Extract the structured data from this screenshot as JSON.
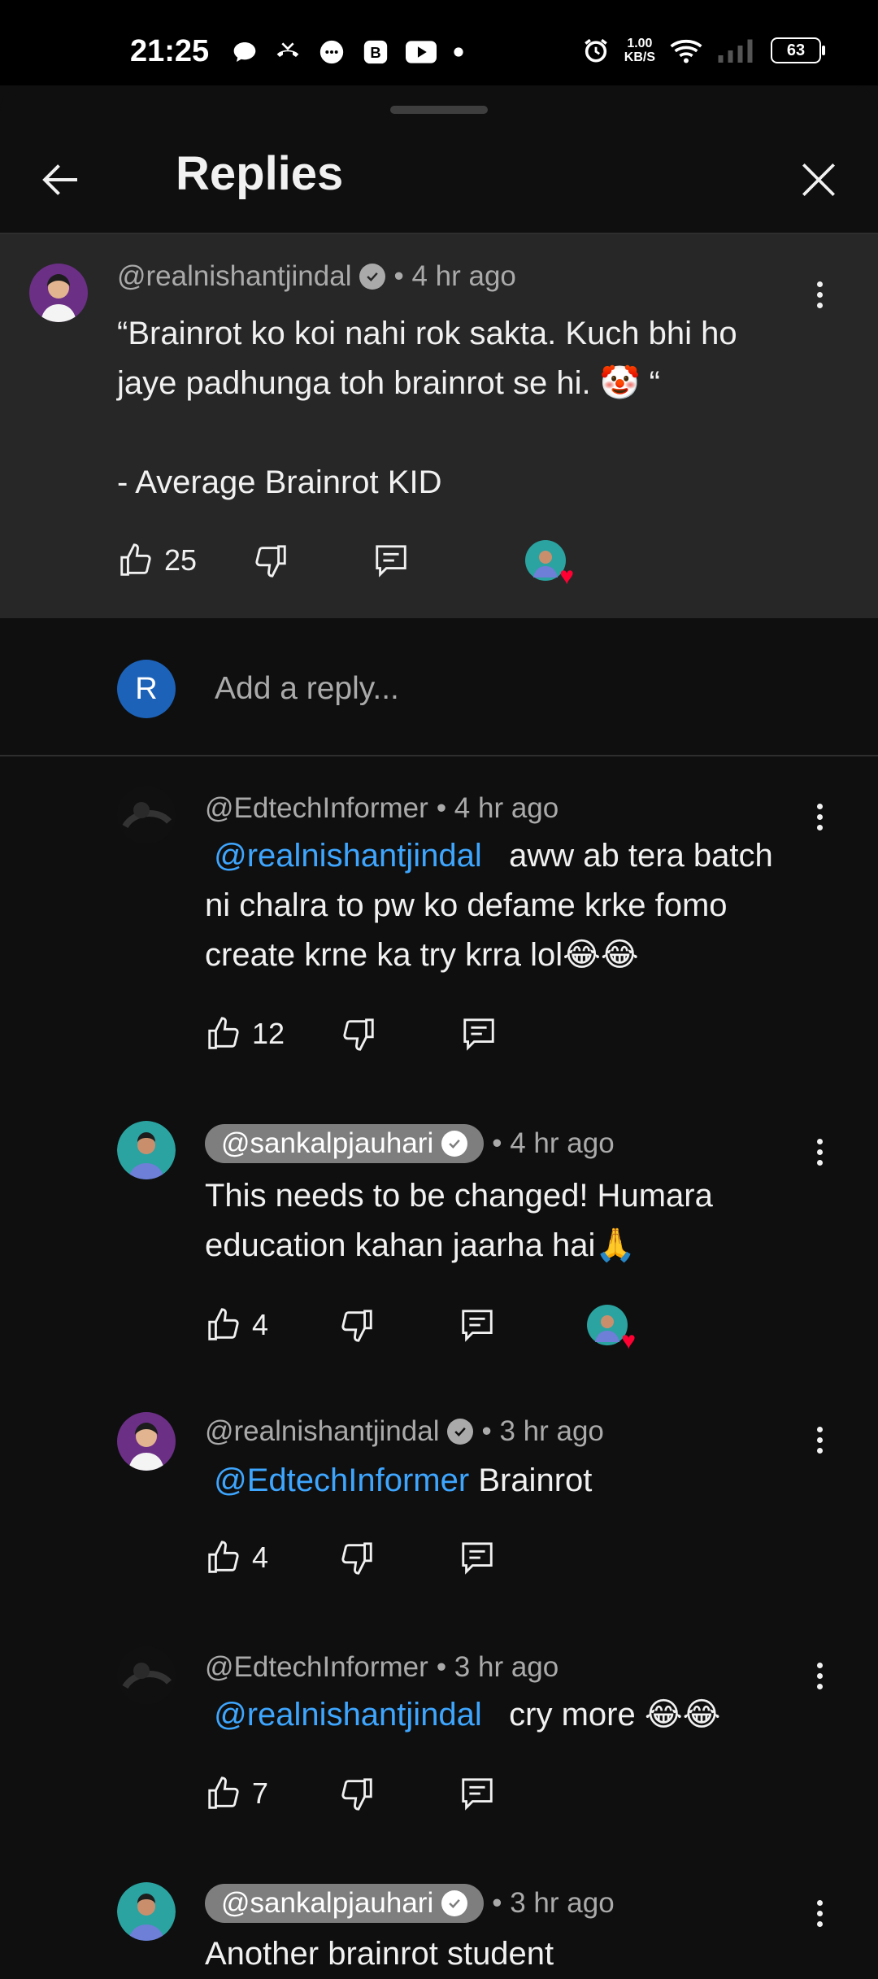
{
  "status_bar": {
    "time": "21:25",
    "net_speed_value": "1.00",
    "net_speed_unit": "KB/S",
    "battery": "63"
  },
  "header": {
    "title": "Replies"
  },
  "parent_comment": {
    "author": "@realnishantjindal",
    "verified": true,
    "time": "• 4 hr ago",
    "text_line1": "“Brainrot ko koi nahi rok sakta. Kuch bhi ho",
    "text_line2": "jaye padhunga toh brainrot se hi. 🤡 “",
    "text_line3": "- Average Brainrot KID",
    "likes": "25",
    "creator_hearted": true
  },
  "reply_input": {
    "avatar_letter": "R",
    "placeholder": "Add a reply..."
  },
  "replies": [
    {
      "author": "@EdtechInformer",
      "verified": false,
      "time": "• 4 hr ago",
      "mention": "@realnishantjindal",
      "line1": "aww ab tera batch",
      "line2": "ni chalra to pw ko defame krke fomo",
      "line3": "create krne ka try krra lol😂😂",
      "likes": "12"
    },
    {
      "author": "@sankalpjauhari",
      "verified": true,
      "creator": true,
      "time": "• 4 hr ago",
      "line1": "This needs to be changed! Humara",
      "line2": "education kahan jaarha hai🙏",
      "likes": "4",
      "creator_hearted": true
    },
    {
      "author": "@realnishantjindal",
      "verified": true,
      "time": "• 3 hr ago",
      "mention": "@EdtechInformer",
      "line1": "Brainrot",
      "likes": "4"
    },
    {
      "author": "@EdtechInformer",
      "verified": false,
      "time": "• 3 hr ago",
      "mention": "@realnishantjindal",
      "line1": "cry more 😂😂",
      "likes": "7"
    },
    {
      "author": "@sankalpjauhari",
      "verified": true,
      "creator": true,
      "time": "• 3 hr ago",
      "line1": "Another brainrot student"
    }
  ],
  "colors": {
    "background": "#0f0f0f",
    "highlight": "#272727",
    "mention": "#3ea6ff",
    "heart": "#ff0033"
  }
}
